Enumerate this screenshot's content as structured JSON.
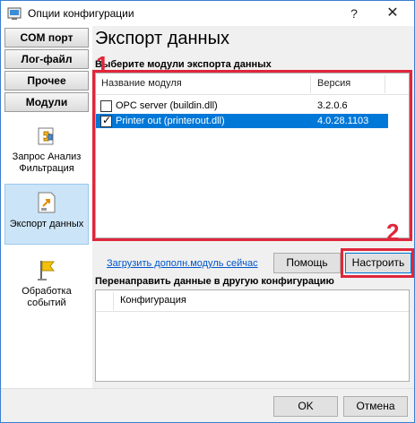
{
  "window": {
    "title": "Опции конфигурации",
    "help_glyph": "?",
    "close_glyph": "✕"
  },
  "sidebar": {
    "tabs": [
      "COM порт",
      "Лог-файл",
      "Прочее",
      "Модули"
    ],
    "items": [
      {
        "label": "Запрос Анализ Фильтрация",
        "icon": "puzzle-icon"
      },
      {
        "label": "Экспорт данных",
        "icon": "export-icon",
        "selected": true
      },
      {
        "label": "Обработка событий",
        "icon": "flag-icon"
      }
    ]
  },
  "main": {
    "section_title": "Экспорт данных",
    "modules_group_label": "Выберите модули экспорта данных",
    "columns": {
      "name": "Название модуля",
      "version": "Версия"
    },
    "modules": [
      {
        "name": "OPC server (buildin.dll)",
        "version": "3.2.0.6",
        "checked": false,
        "selected": false
      },
      {
        "name": "Printer out (printerout.dll)",
        "version": "4.0.28.1103",
        "checked": true,
        "selected": true
      }
    ],
    "load_link": "Загрузить дополн.модуль сейчас",
    "help_button": "Помощь",
    "configure_button": "Настроить",
    "redirect_group_label": "Перенаправить данные в другую конфигурацию",
    "redirect_column": "Конфигурация"
  },
  "annotations": {
    "marker_1": "1",
    "marker_2": "2",
    "color": "#e0263b"
  },
  "footer": {
    "ok_button": "OK",
    "cancel_button": "Отмена"
  },
  "colors": {
    "selection": "#0078d7",
    "sidebar_selection": "#cce4f7",
    "link": "#0055cc"
  }
}
